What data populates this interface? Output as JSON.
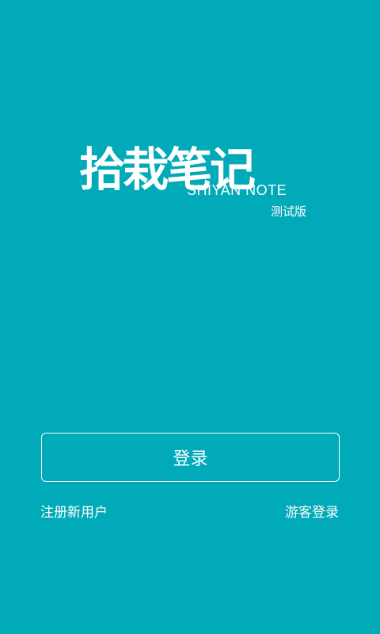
{
  "app": {
    "logo_cn": "拾栽笔记",
    "logo_en": "SHIYAN NOTE",
    "edition": "测试版"
  },
  "actions": {
    "login_label": "登录",
    "register_label": "注册新用户",
    "guest_label": "游客登录"
  },
  "theme": {
    "background": "#01aab8",
    "foreground": "#ffffff"
  }
}
